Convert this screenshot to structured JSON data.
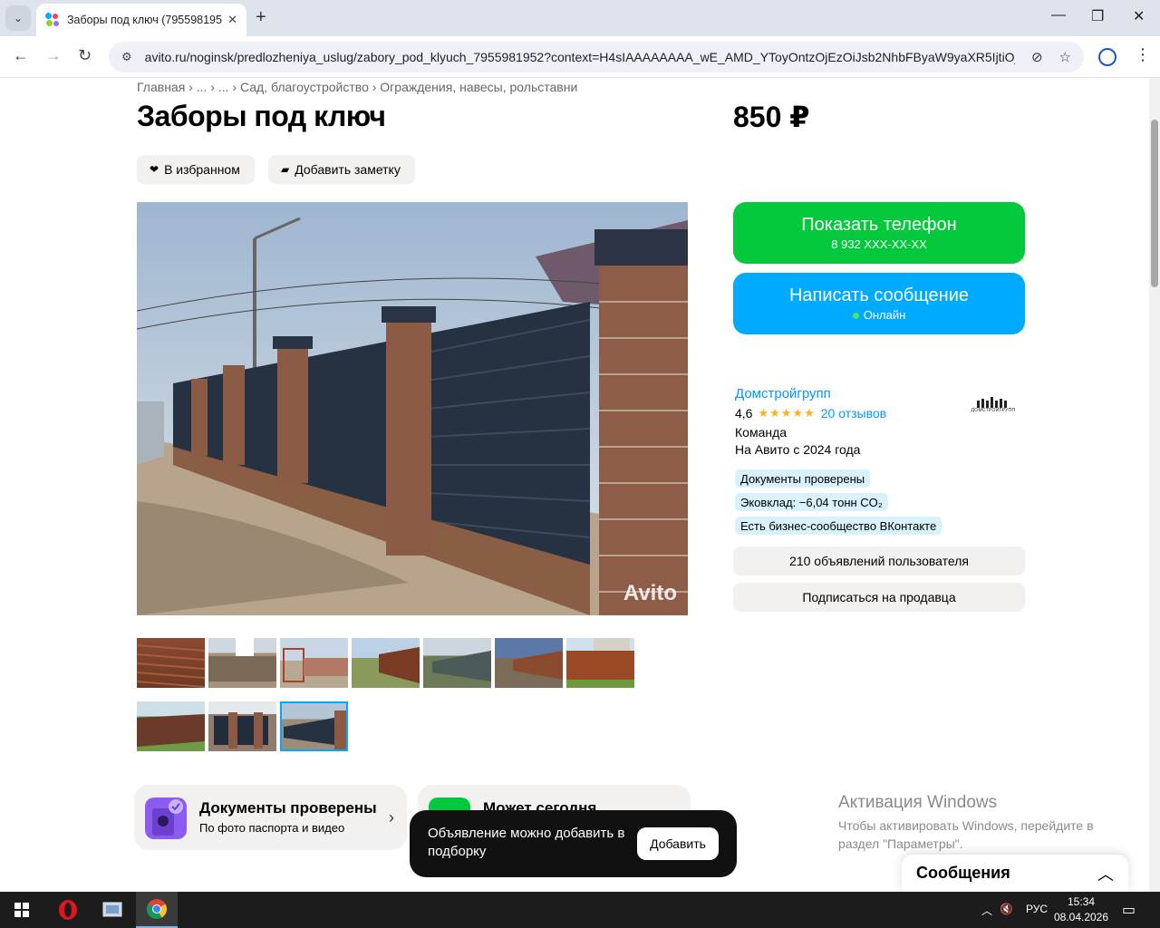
{
  "browser": {
    "tab_title": "Заборы под ключ (795598195...",
    "url": "avito.ru/noginsk/predlozheniya_uslug/zabory_pod_klyuch_7955981952?context=H4sIAAAAAAAA_wE_AMD_YToyOntzOjEzOiJsb2NhbFByaW9yaXR5IjtiOjA7..."
  },
  "listing": {
    "breadcrumbs": "Главная › ... › ... › Сад, благоустройство › Ограждения, навесы, рольставни",
    "title": "Заборы под ключ",
    "price": "850 ₽",
    "favorite_label": "В избранном",
    "note_label": "Добавить заметку",
    "watermark": "Avito"
  },
  "contact": {
    "phone_title": "Показать телефон",
    "phone_number": "8 932 XXX-XX-XX",
    "message_title": "Написать сообщение",
    "online": "Онлайн"
  },
  "seller": {
    "name": "Домстройгрупп",
    "rating": "4,6",
    "stars": "★★★★★",
    "reviews": "20 отзывов",
    "type": "Команда",
    "since": "На Авито с 2024 года",
    "logo_text": "ДОМСТРОЙГРУПП",
    "badges": [
      "Документы проверены",
      "Эковклад: −6,04 тонн CO₂",
      "Есть бизнес-сообщество ВКонтакте"
    ],
    "ads_button": "210 объявлений пользователя",
    "subscribe_button": "Подписаться на продавца"
  },
  "cards": {
    "docs_title": "Документы проверены",
    "docs_sub": "По фото паспорта и видео",
    "today_title": "Может сегодня"
  },
  "toast": {
    "text": "Объявление можно добавить в подборку",
    "button": "Добавить"
  },
  "windows": {
    "activation_title": "Активация Windows",
    "activation_sub": "Чтобы активировать Windows, перейдите в раздел \"Параметры\"."
  },
  "messages": {
    "label": "Сообщения"
  },
  "taskbar": {
    "lang": "РУС",
    "time": "15:34",
    "date": "08.04.2026"
  },
  "colors": {
    "green": "#04c93c",
    "blue": "#00aaff",
    "link": "#0099f7",
    "star": "#ffb021"
  }
}
